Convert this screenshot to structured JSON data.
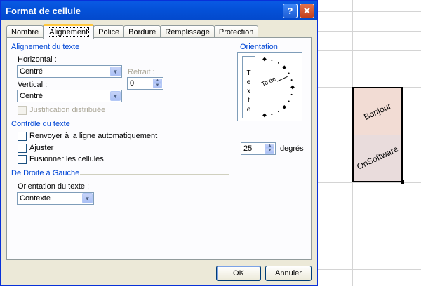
{
  "dialog": {
    "title": "Format de cellule",
    "help_glyph": "?",
    "close_glyph": "✕"
  },
  "tabs": [
    {
      "label": "Nombre"
    },
    {
      "label": "Alignement"
    },
    {
      "label": "Police"
    },
    {
      "label": "Bordure"
    },
    {
      "label": "Remplissage"
    },
    {
      "label": "Protection"
    }
  ],
  "active_tab": "Alignement",
  "alignment": {
    "group_title": "Alignement du texte",
    "horizontal_label": "Horizontal :",
    "horizontal_value": "Centré",
    "indent_label": "Retrait :",
    "indent_value": "0",
    "vertical_label": "Vertical :",
    "vertical_value": "Centré",
    "justify_distributed_label": "Justification distribuée"
  },
  "text_control": {
    "group_title": "Contrôle du texte",
    "wrap_label": "Renvoyer à la ligne automatiquement",
    "shrink_label": "Ajuster",
    "merge_label": "Fusionner les cellules"
  },
  "rtl": {
    "group_title": "De Droite à Gauche",
    "direction_label": "Orientation du texte :",
    "direction_value": "Contexte"
  },
  "orientation": {
    "group_title": "Orientation",
    "vertical_letters": [
      "T",
      "e",
      "x",
      "t",
      "e"
    ],
    "dial_text": "Texte",
    "degrees_value": "25",
    "degrees_label": "degrés",
    "angle_degrees": 25
  },
  "buttons": {
    "ok": "OK",
    "cancel": "Annuler"
  },
  "spreadsheet": {
    "cell_top_text": "Bonjour",
    "cell_bottom_text": "OnSoftware",
    "rotation_degrees": 25
  },
  "icons": {
    "dropdown_arrow": "▼",
    "spin_up": "▲",
    "spin_down": "▼"
  },
  "colors": {
    "title_bar": "#0451d8",
    "group_title": "#0046d5",
    "active_tab_highlight": "#ffc83c",
    "cell_top_fill": "#f2dcd4",
    "cell_bottom_fill": "#e9dcdc"
  }
}
